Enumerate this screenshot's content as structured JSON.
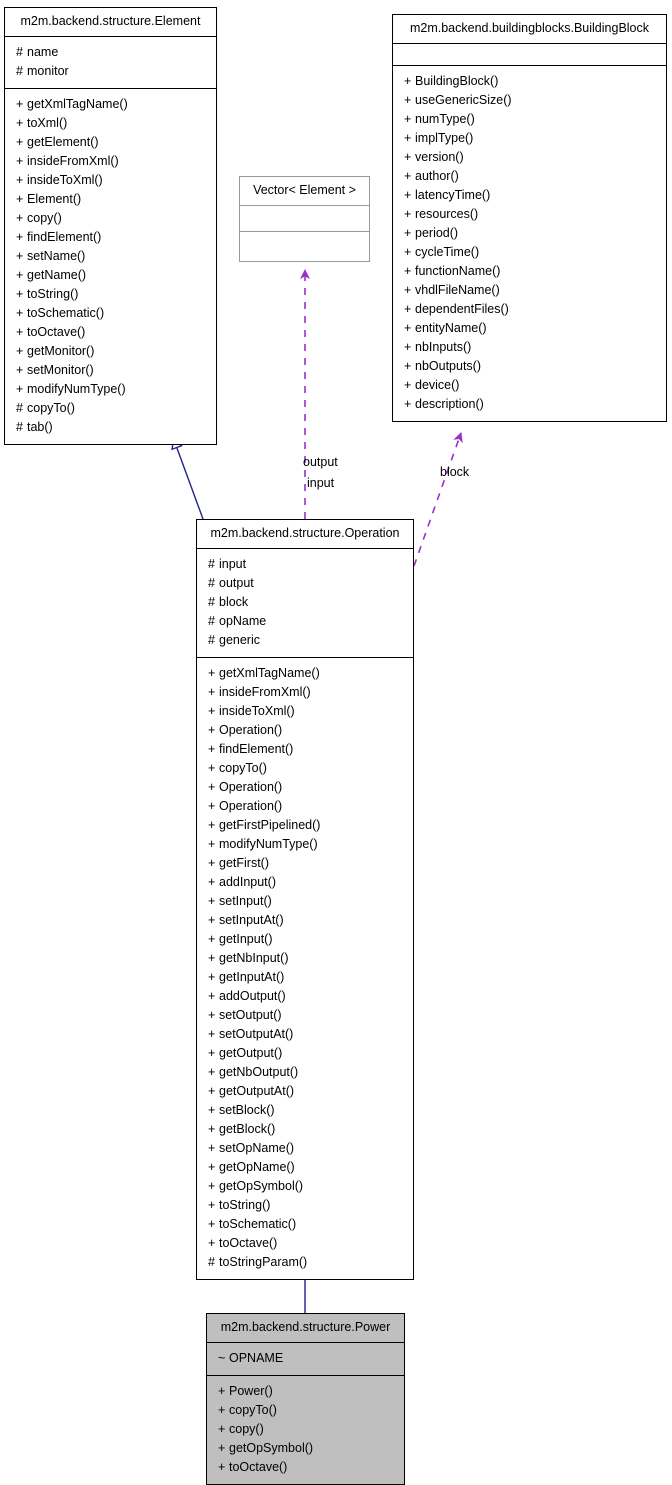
{
  "diagram": {
    "kind": "uml-class-diagram",
    "colors": {
      "inheritance_line": "#22228c",
      "association_line": "#9b30c8",
      "node_border": "#000000",
      "light_node_border": "#9a9a9a",
      "highlight_fill": "#bfbfbf",
      "background": "#ffffff",
      "text": "#000000"
    }
  },
  "nodes": {
    "element": {
      "title": "m2m.backend.structure.Element",
      "attributes": [
        "# name",
        "# monitor"
      ],
      "operations": [
        "+ getXmlTagName()",
        "+ toXml()",
        "+ getElement()",
        "+ insideFromXml()",
        "+ insideToXml()",
        "+ Element()",
        "+ copy()",
        "+ findElement()",
        "+ setName()",
        "+ getName()",
        "+ toString()",
        "+ toSchematic()",
        "+ toOctave()",
        "+ getMonitor()",
        "+ setMonitor()",
        "+ modifyNumType()",
        "# copyTo()",
        "# tab()"
      ]
    },
    "buildingblock": {
      "title": "m2m.backend.buildingblocks.BuildingBlock",
      "attributes": [],
      "operations": [
        "+ BuildingBlock()",
        "+ useGenericSize()",
        "+ numType()",
        "+ implType()",
        "+ version()",
        "+ author()",
        "+ latencyTime()",
        "+ resources()",
        "+ period()",
        "+ cycleTime()",
        "+ functionName()",
        "+ vhdlFileName()",
        "+ dependentFiles()",
        "+ entityName()",
        "+ nbInputs()",
        "+ nbOutputs()",
        "+ device()",
        "+ description()"
      ]
    },
    "vector": {
      "title": "Vector< Element >",
      "attributes": [],
      "operations": []
    },
    "operation": {
      "title": "m2m.backend.structure.Operation",
      "attributes": [
        "# input",
        "# output",
        "# block",
        "# opName",
        "# generic"
      ],
      "operations": [
        "+ getXmlTagName()",
        "+ insideFromXml()",
        "+ insideToXml()",
        "+ Operation()",
        "+ findElement()",
        "+ copyTo()",
        "+ Operation()",
        "+ Operation()",
        "+ getFirstPipelined()",
        "+ modifyNumType()",
        "+ getFirst()",
        "+ addInput()",
        "+ setInput()",
        "+ setInputAt()",
        "+ getInput()",
        "+ getNbInput()",
        "+ getInputAt()",
        "+ addOutput()",
        "+ setOutput()",
        "+ setOutputAt()",
        "+ getOutput()",
        "+ getNbOutput()",
        "+ getOutputAt()",
        "+ setBlock()",
        "+ getBlock()",
        "+ setOpName()",
        "+ getOpName()",
        "+ getOpSymbol()",
        "+ toString()",
        "+ toSchematic()",
        "+ toOctave()",
        "# toStringParam()"
      ]
    },
    "power": {
      "title": "m2m.backend.structure.Power",
      "attributes": [
        "~ OPNAME"
      ],
      "operations": [
        "+ Power()",
        "+ copyTo()",
        "+ copy()",
        "+ getOpSymbol()",
        "+ toOctave()"
      ]
    }
  },
  "edges": [
    {
      "name": "operation-inherits-element",
      "from": "operation",
      "to": "element",
      "type": "inheritance",
      "label": ""
    },
    {
      "name": "power-inherits-operation",
      "from": "power",
      "to": "operation",
      "type": "inheritance",
      "label": ""
    },
    {
      "name": "operation-uses-vector",
      "from": "operation",
      "to": "vector",
      "type": "association",
      "label": "output\ninput"
    },
    {
      "name": "operation-uses-buildingblock",
      "from": "operation",
      "to": "buildingblock",
      "type": "association",
      "label": "block"
    }
  ],
  "edge_labels": {
    "output": "output",
    "input": "input",
    "block": "block"
  }
}
